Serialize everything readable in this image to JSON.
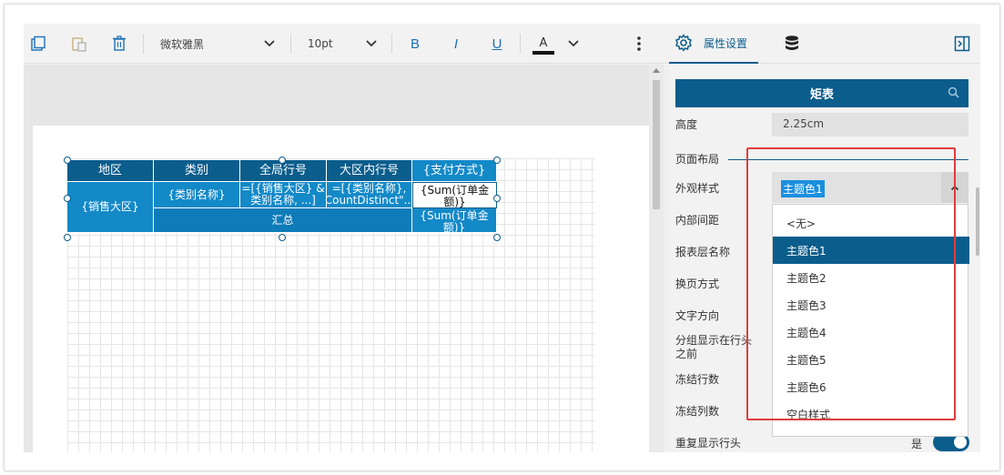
{
  "toolbar": {
    "font_name": "微软雅黑",
    "font_size": "10pt",
    "bold": "B",
    "italic": "I",
    "underline": "U",
    "font_color_letter": "A"
  },
  "panel_tabs": {
    "properties_label": "属性设置"
  },
  "table": {
    "headers": [
      "地区",
      "类别",
      "全局行号",
      "大区内行号",
      "{支付方式}"
    ],
    "region_cell": "{销售大区}",
    "category_cell": "{类别名称}",
    "global_row_cell": "=[{销售大区} & 类别名称, ...]",
    "region_row_cell": "=[{类别名称}, \"CountDistinct\"...]",
    "sum_cell_1": "{Sum(订单金额)}",
    "total_label": "汇总",
    "sum_cell_2": "{Sum(订单金额)}"
  },
  "properties": {
    "matrix_button": "矩表",
    "height_label": "高度",
    "height_value": "2.25cm",
    "layout_section": "页面布局",
    "appearance_label": "外观样式",
    "appearance_value": "主题色1",
    "padding_label": "内部间距",
    "layer_name_label": "报表层名称",
    "page_break_label": "换页方式",
    "text_direction_label": "文字方向",
    "group_before_header_label": "分组显示在行头之前",
    "freeze_rows_label": "冻结行数",
    "freeze_cols_label": "冻结列数",
    "repeat_header_label": "重复显示行头",
    "repeat_header_value": "是"
  },
  "dropdown": {
    "options": [
      "<无>",
      "主题色1",
      "主题色2",
      "主题色3",
      "主题色4",
      "主题色5",
      "主题色6",
      "空白样式"
    ],
    "selected": "主题色1"
  },
  "colors": {
    "accent": "#0b5d8c",
    "cell_blue": "#1389c8",
    "highlight_red": "#e03c3c"
  }
}
